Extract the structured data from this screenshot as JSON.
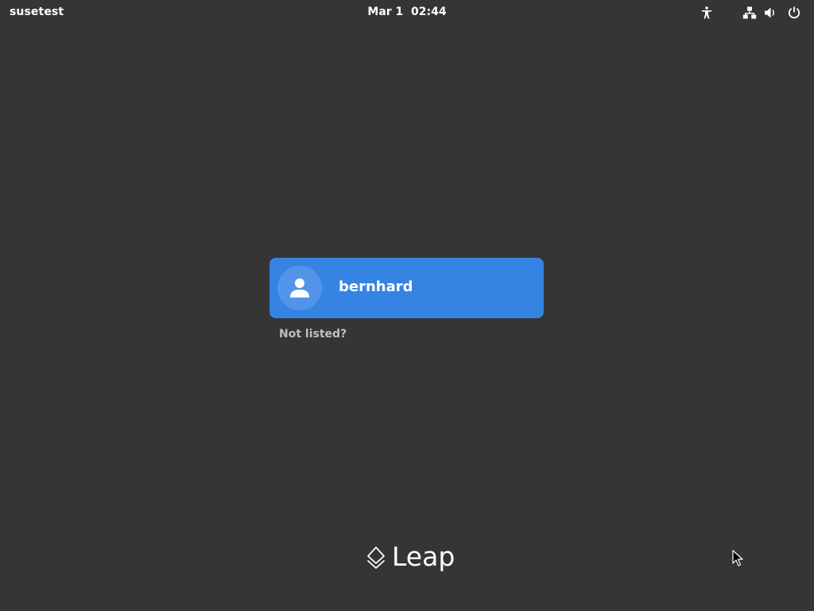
{
  "topbar": {
    "hostname": "susetest",
    "clock": "Mar 1  02:44",
    "icons": [
      "accessibility-icon",
      "network-wired-icon",
      "volume-icon",
      "power-icon"
    ]
  },
  "login": {
    "users": [
      {
        "name": "bernhard",
        "avatar_icon": "user-avatar-icon"
      }
    ],
    "not_listed_label": "Not listed?"
  },
  "branding": {
    "logo_text": "Leap",
    "logo_icon": "leap-diamond-icon"
  },
  "colors": {
    "background": "#353535",
    "accent": "#3584e4",
    "muted_text": "#c0bfbc"
  }
}
